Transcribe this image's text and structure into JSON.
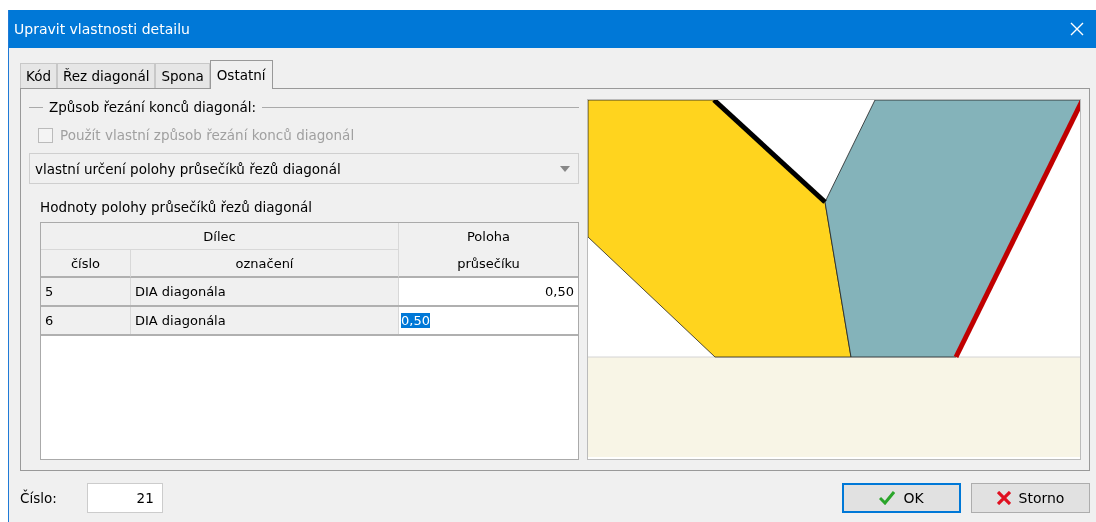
{
  "window": {
    "title": "Upravit vlastnosti detailu"
  },
  "tabs": [
    {
      "label": "Kód",
      "selected": false
    },
    {
      "label": "Řez diagonál",
      "selected": false
    },
    {
      "label": "Spona",
      "selected": false
    },
    {
      "label": "Ostatní",
      "selected": true
    }
  ],
  "group": {
    "title": "Způsob řezání konců diagonál:",
    "checkbox": {
      "label": "Použít vlastní způsob řezání konců diagonál",
      "checked": false,
      "disabled": true
    },
    "dropdown": {
      "value": "vlastní určení polohy průsečíků řezů diagonál"
    }
  },
  "table": {
    "title": "Hodnoty polohy průsečíků řezů diagonál",
    "group_header": "Dílec",
    "columns": [
      "číslo",
      "označení"
    ],
    "position_header": [
      "Poloha",
      "průsečíku"
    ],
    "rows": [
      {
        "cislo": "5",
        "oznaceni": "DIA diagonála",
        "poloha": "0,50",
        "selected": false
      },
      {
        "cislo": "6",
        "oznaceni": "DIA diagonála",
        "poloha": "0,50",
        "selected": true
      }
    ]
  },
  "number": {
    "label": "Číslo:",
    "value": "21"
  },
  "buttons": [
    {
      "kind": "ok",
      "label": "OK"
    },
    {
      "kind": "cancel",
      "label": "Storno"
    }
  ]
}
